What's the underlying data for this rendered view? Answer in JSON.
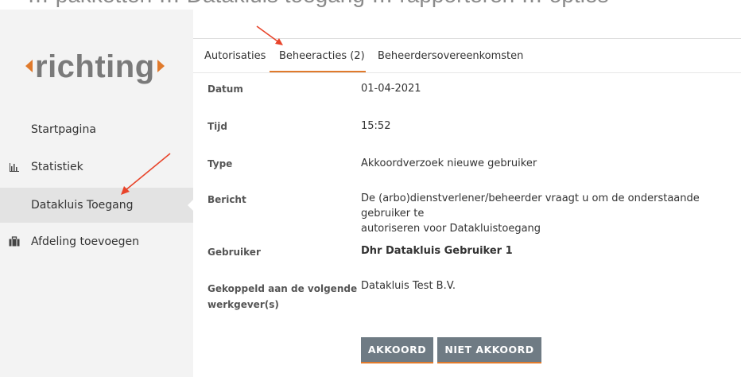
{
  "header_cut_text": "… pakketten … Datakluis toegang … rapporteren … opties",
  "logo": {
    "text": "richting"
  },
  "sidebar": {
    "items": [
      {
        "label": "Startpagina",
        "icon": ""
      },
      {
        "label": "Statistiek",
        "icon": "bar-chart-icon"
      },
      {
        "label": "Datakluis Toegang",
        "icon": "",
        "active": true
      },
      {
        "label": "Afdeling toevoegen",
        "icon": "briefcase-icon"
      }
    ]
  },
  "tabs": [
    {
      "label": "Autorisaties"
    },
    {
      "label": "Beheeracties (2)",
      "active": true
    },
    {
      "label": "Beheerdersovereenkomsten"
    }
  ],
  "details": {
    "datum": {
      "label": "Datum",
      "value": "01-04-2021"
    },
    "tijd": {
      "label": "Tijd",
      "value": "15:52"
    },
    "type": {
      "label": "Type",
      "value": "Akkoordverzoek nieuwe gebruiker"
    },
    "bericht": {
      "label": "Bericht",
      "value_line1": "De (arbo)dienstverlener/beheerder vraagt u om de onderstaande gebruiker te",
      "value_line2": "autoriseren voor Datakluistoegang"
    },
    "gebruiker": {
      "label": "Gebruiker",
      "value": "Dhr Datakluis Gebruiker 1"
    },
    "werkgever": {
      "label_line1": "Gekoppeld aan de volgende",
      "label_line2": "werkgever(s)",
      "value": "Datakluis Test B.V."
    }
  },
  "buttons": {
    "accept": "AKKOORD",
    "decline": "NIET AKKOORD"
  },
  "colors": {
    "accent": "#e07a2c",
    "button": "#6f7b84",
    "sidebar": "#f3f3f3",
    "annotation_arrow": "#e8442a"
  }
}
